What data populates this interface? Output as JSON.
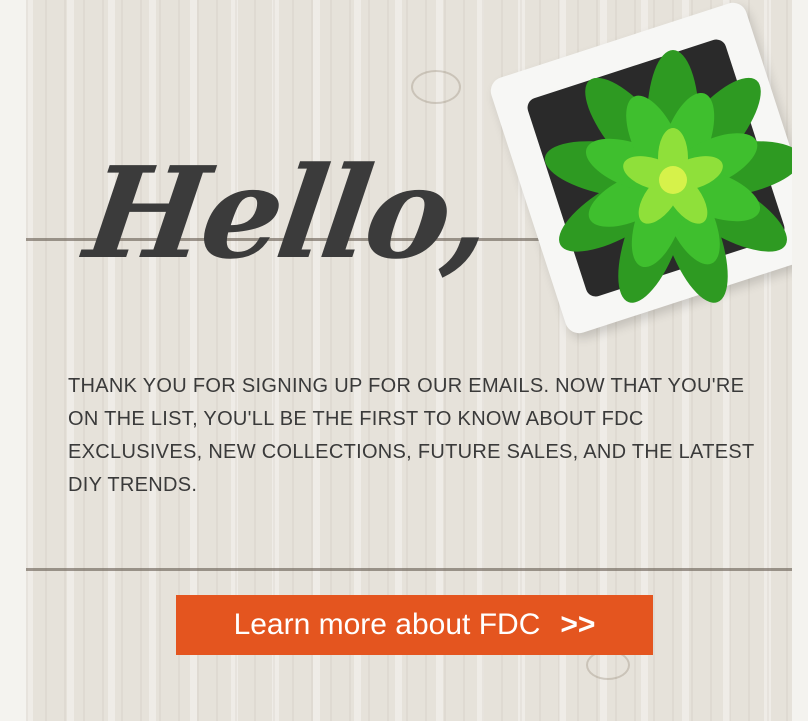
{
  "greeting": "Hello,",
  "message": "Thank you for signing up for our emails. Now that you're on the list, you'll be the first to know about FDC exclusives, new collections, future sales, and the latest DIY trends.",
  "cta": {
    "label": "Learn more about FDC",
    "arrows": ">>"
  },
  "colors": {
    "cta_background": "#e4551f",
    "text": "#3a3a3a",
    "wood": "#e6e2da",
    "succulent": "#3fbf2e"
  },
  "icons": {
    "plant": "succulent-plant-icon"
  }
}
